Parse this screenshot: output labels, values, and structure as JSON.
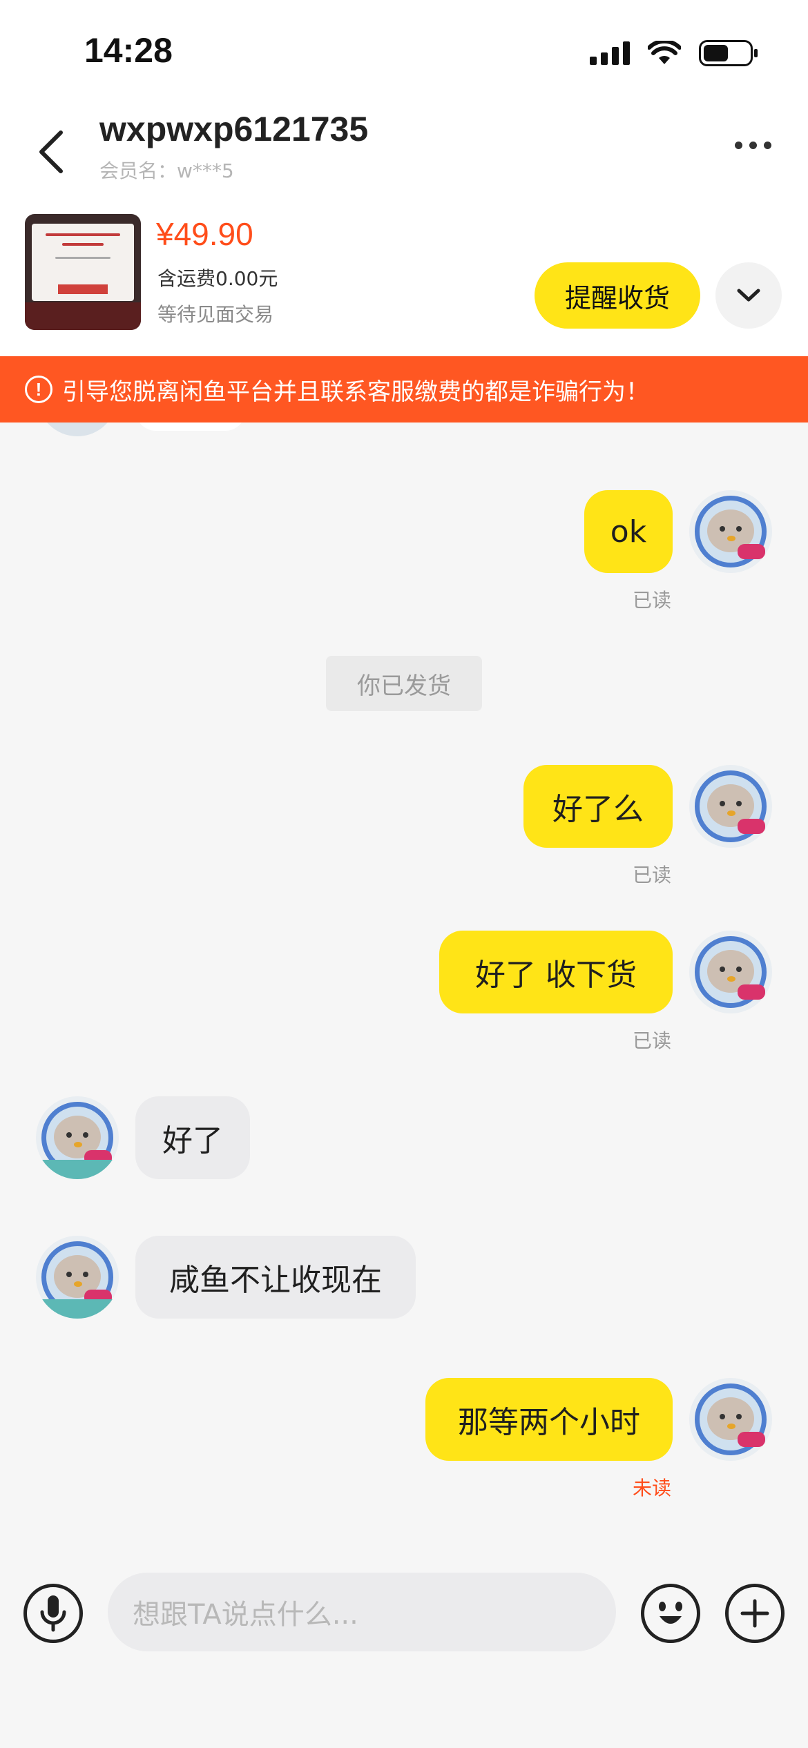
{
  "status_bar": {
    "time": "14:28",
    "battery_level": 0.55
  },
  "header": {
    "contact_name": "wxpwxp6121735",
    "member_label": "会员名：w***5"
  },
  "order": {
    "price": "¥49.90",
    "shipping": "含运费0.00元",
    "status": "等待见面交易",
    "remind_button": "提醒收货"
  },
  "warning": {
    "icon": "!",
    "text": "引导您脱离闲鱼平台并且联系客服缴费的都是诈骗行为！"
  },
  "messages": [
    {
      "side": "mine",
      "text": "ok",
      "receipt": "已读"
    },
    {
      "side": "system",
      "text": "你已发货"
    },
    {
      "side": "mine",
      "text": "好了么",
      "receipt": "已读"
    },
    {
      "side": "mine",
      "text": "好了 收下货",
      "receipt": "已读"
    },
    {
      "side": "theirs",
      "text": "好了"
    },
    {
      "side": "theirs",
      "text": "咸鱼不让收现在"
    },
    {
      "side": "mine",
      "text": "那等两个小时",
      "receipt": "未读"
    }
  ],
  "input": {
    "placeholder": "想跟TA说点什么..."
  },
  "colors": {
    "accent_yellow": "#ffe417",
    "warning_orange": "#ff5722",
    "price_red": "#ff4d1a"
  },
  "icons": {
    "back": "chevron-left-icon",
    "more": "more-dots-icon",
    "expand": "chevron-down-icon",
    "warning": "exclamation-circle-icon",
    "mic": "microphone-icon",
    "emoji": "smiley-icon",
    "plus": "plus-circle-icon"
  }
}
